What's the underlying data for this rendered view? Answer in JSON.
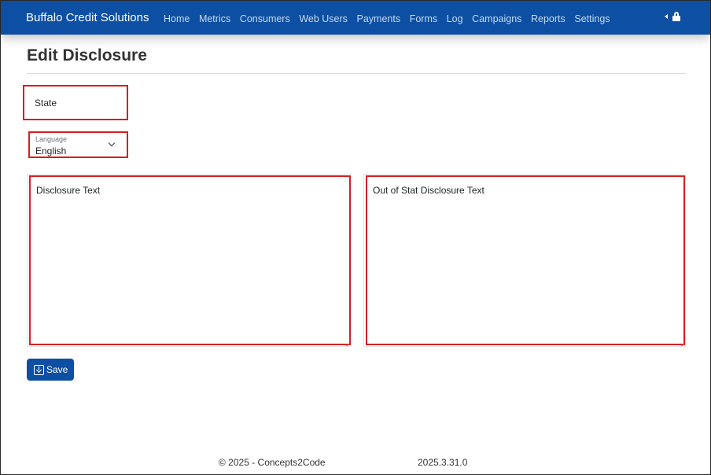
{
  "navbar": {
    "brand": "Buffalo Credit Solutions",
    "links": [
      "Home",
      "Metrics",
      "Consumers",
      "Web Users",
      "Payments",
      "Forms",
      "Log",
      "Campaigns",
      "Reports",
      "Settings"
    ],
    "right_icons": [
      "caret-left-icon",
      "lock-icon"
    ]
  },
  "page": {
    "title": "Edit Disclosure"
  },
  "form": {
    "state_placeholder": "State",
    "state_value": "",
    "language_label": "Language",
    "language_value": "English",
    "disclosure_placeholder": "Disclosure Text",
    "out_of_state_placeholder": "Out of Stat Disclosure Text",
    "save_label": "Save"
  },
  "footer": {
    "copyright": "© 2025 - Concepts2Code",
    "version": "2025.3.31.0"
  },
  "colors": {
    "navbar_bg": "#0d4fa3",
    "highlight_border": "#d62020",
    "button_bg": "#0d4fa3"
  }
}
